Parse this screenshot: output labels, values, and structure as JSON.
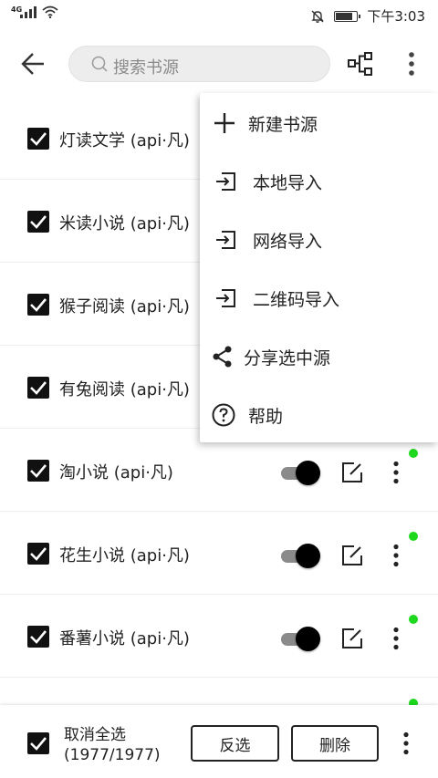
{
  "status_bar": {
    "network": "4G",
    "time": "下午3:03",
    "battery_level": 0.85
  },
  "toolbar": {
    "search_placeholder": "搜索书源",
    "back_icon": "arrow-back-icon",
    "group_icon": "group-icon",
    "more_icon": "more-vert-icon"
  },
  "sources": [
    {
      "name": "灯读文学 (api·凡)",
      "checked": true
    },
    {
      "name": "米读小说 (api·凡)",
      "checked": true
    },
    {
      "name": "猴子阅读 (api·凡)",
      "checked": true
    },
    {
      "name": "有兔阅读 (api·凡)",
      "checked": true
    },
    {
      "name": "淘小说 (api·凡)",
      "checked": true,
      "enabled": true
    },
    {
      "name": "花生小说 (api·凡)",
      "checked": true,
      "enabled": true
    },
    {
      "name": "番薯小说 (api·凡)",
      "checked": true,
      "enabled": true
    }
  ],
  "menu": {
    "items": [
      {
        "label": "新建书源",
        "icon": "plus-icon"
      },
      {
        "label": "本地导入",
        "icon": "import-icon"
      },
      {
        "label": "网络导入",
        "icon": "import-icon"
      },
      {
        "label": "二维码导入",
        "icon": "import-icon"
      },
      {
        "label": "分享选中源",
        "icon": "share-icon"
      },
      {
        "label": "帮助",
        "icon": "help-icon"
      }
    ]
  },
  "bottom": {
    "select_label": "取消全选",
    "count": "(1977/1977)",
    "invert_label": "反选",
    "delete_label": "删除"
  },
  "colors": {
    "accent": "#000000",
    "online_dot": "#1ed81e",
    "switch_track": "#8a8a8a"
  }
}
